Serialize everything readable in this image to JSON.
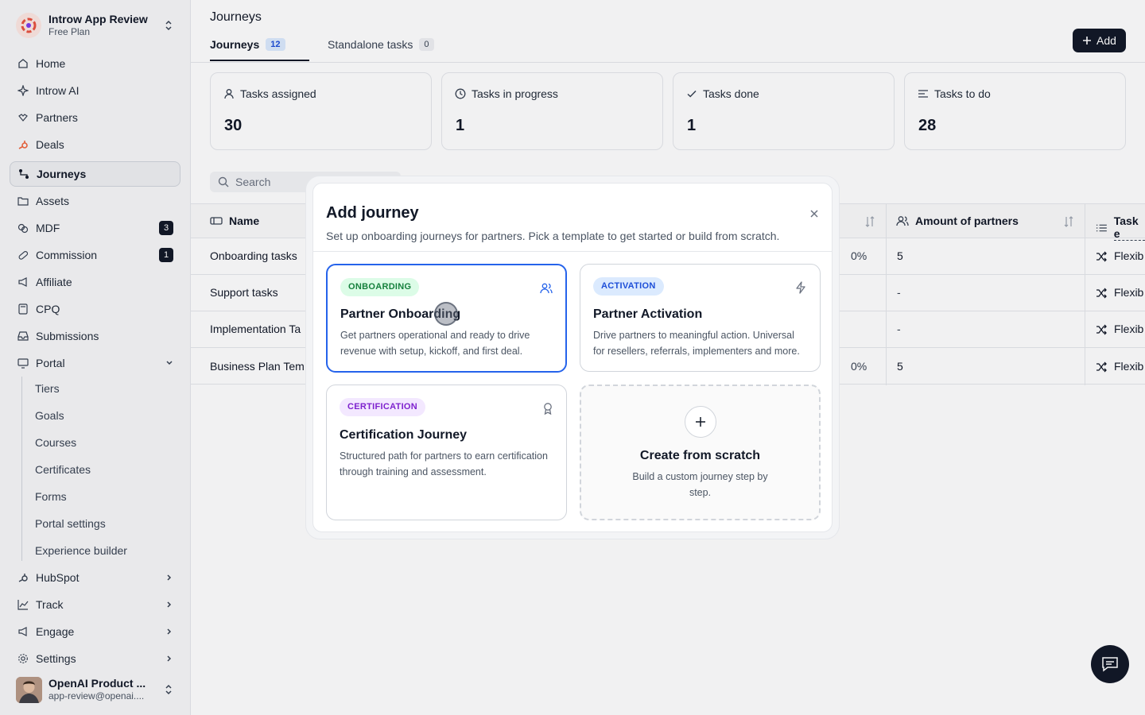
{
  "workspace": {
    "name": "Introw App Review",
    "plan": "Free Plan"
  },
  "sidebar": {
    "items": [
      {
        "label": "Home",
        "icon": "home-icon"
      },
      {
        "label": "Introw AI",
        "icon": "sparkle-icon"
      },
      {
        "label": "Partners",
        "icon": "handshake-icon"
      },
      {
        "label": "Deals",
        "icon": "hubspot-icon"
      },
      {
        "label": "Journeys",
        "icon": "journey-icon"
      },
      {
        "label": "Assets",
        "icon": "folder-icon"
      },
      {
        "label": "MDF",
        "icon": "coins-icon",
        "badge": "3"
      },
      {
        "label": "Commission",
        "icon": "pill-icon",
        "badge": "1"
      },
      {
        "label": "Affiliate",
        "icon": "megaphone-icon"
      },
      {
        "label": "CPQ",
        "icon": "calculator-icon"
      },
      {
        "label": "Submissions",
        "icon": "inbox-icon"
      },
      {
        "label": "Portal",
        "icon": "monitor-icon"
      }
    ],
    "portal_sub": [
      "Tiers",
      "Goals",
      "Courses",
      "Certificates",
      "Forms",
      "Portal settings",
      "Experience builder"
    ],
    "bottom": [
      {
        "label": "HubSpot",
        "icon": "hubspot-icon"
      },
      {
        "label": "Track",
        "icon": "chart-line-icon"
      },
      {
        "label": "Engage",
        "icon": "megaphone-icon"
      },
      {
        "label": "Settings",
        "icon": "gear-icon"
      }
    ],
    "user": {
      "name": "OpenAI Product ...",
      "email": "app-review@openai...."
    }
  },
  "page": {
    "title": "Journeys",
    "tabs": [
      {
        "label": "Journeys",
        "count": "12"
      },
      {
        "label": "Standalone tasks",
        "count": "0"
      }
    ],
    "add_label": "Add"
  },
  "stats": [
    {
      "label": "Tasks assigned",
      "value": "30"
    },
    {
      "label": "Tasks in progress",
      "value": "1"
    },
    {
      "label": "Tasks done",
      "value": "1"
    },
    {
      "label": "Tasks to do",
      "value": "28"
    }
  ],
  "search": {
    "placeholder": "Search"
  },
  "table": {
    "columns": [
      "Name",
      "Amount of partners",
      "Task e"
    ],
    "rows": [
      {
        "name": "Onboarding tasks",
        "pct": "0%",
        "partners": "5",
        "type": "Flexib"
      },
      {
        "name": "Support tasks",
        "pct": "",
        "partners": "-",
        "type": "Flexib"
      },
      {
        "name": "Implementation Ta",
        "pct": "",
        "partners": "-",
        "type": "Flexib"
      },
      {
        "name": "Business Plan Tem",
        "pct": "0%",
        "partners": "5",
        "type": "Flexib"
      }
    ]
  },
  "modal": {
    "title": "Add journey",
    "subtitle": "Set up onboarding journeys for partners. Pick a template to get started or build from scratch.",
    "cards": [
      {
        "tag": "ONBOARDING",
        "title": "Partner Onboarding",
        "desc": "Get partners operational and ready to drive revenue with setup, kickoff, and first deal.",
        "tag_bg": "#dcfce7",
        "tag_fg": "#15803d"
      },
      {
        "tag": "ACTIVATION",
        "title": "Partner Activation",
        "desc": "Drive partners to meaningful action. Universal for resellers, referrals, implementers and more.",
        "tag_bg": "#dbeafe",
        "tag_fg": "#1d4ed8"
      },
      {
        "tag": "CERTIFICATION",
        "title": "Certification Journey",
        "desc": "Structured path for partners to earn certification through training and assessment.",
        "tag_bg": "#f3e8ff",
        "tag_fg": "#7e22ce"
      }
    ],
    "scratch": {
      "title": "Create from scratch",
      "desc": "Build a custom journey step by step."
    }
  },
  "colors": {
    "accent": "#2563eb",
    "dark": "#111827"
  }
}
